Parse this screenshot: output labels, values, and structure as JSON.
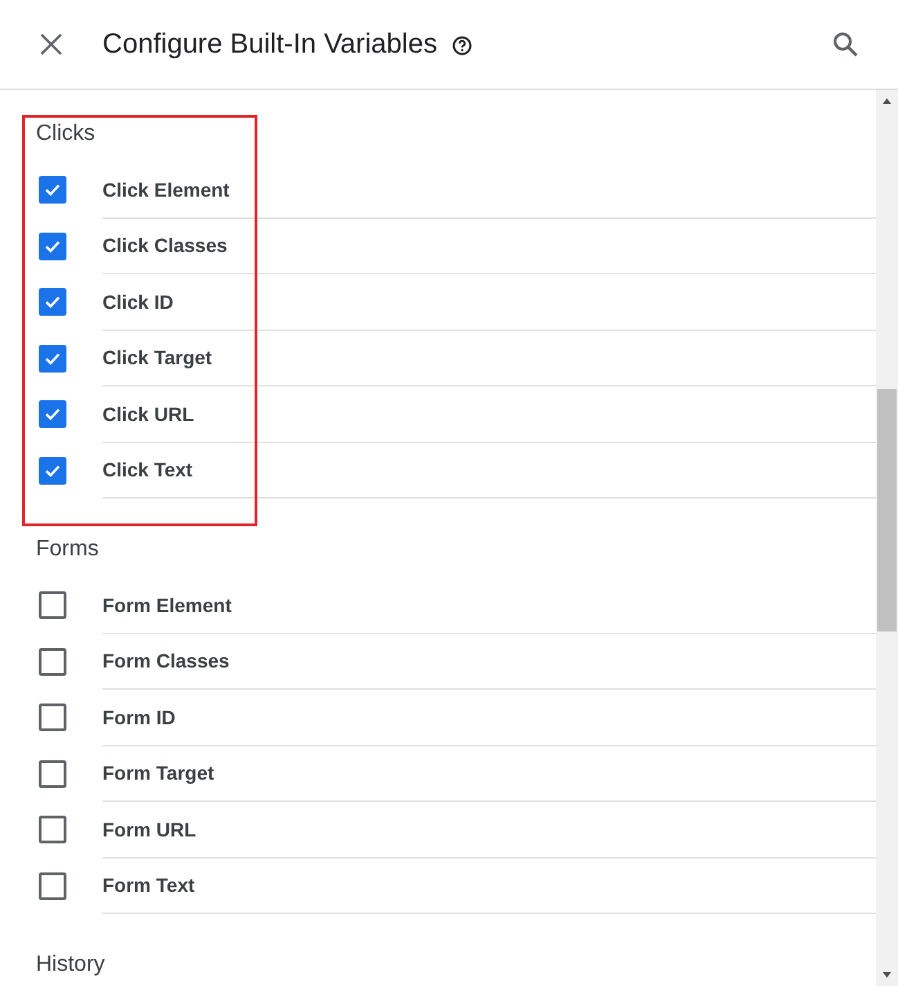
{
  "header": {
    "title": "Configure Built-In Variables"
  },
  "sections": [
    {
      "title": "Clicks",
      "highlighted": true,
      "items": [
        {
          "label": "Click Element",
          "checked": true
        },
        {
          "label": "Click Classes",
          "checked": true
        },
        {
          "label": "Click ID",
          "checked": true
        },
        {
          "label": "Click Target",
          "checked": true
        },
        {
          "label": "Click URL",
          "checked": true
        },
        {
          "label": "Click Text",
          "checked": true
        }
      ]
    },
    {
      "title": "Forms",
      "items": [
        {
          "label": "Form Element",
          "checked": false
        },
        {
          "label": "Form Classes",
          "checked": false
        },
        {
          "label": "Form ID",
          "checked": false
        },
        {
          "label": "Form Target",
          "checked": false
        },
        {
          "label": "Form URL",
          "checked": false
        },
        {
          "label": "Form Text",
          "checked": false
        }
      ]
    },
    {
      "title": "History"
    }
  ]
}
